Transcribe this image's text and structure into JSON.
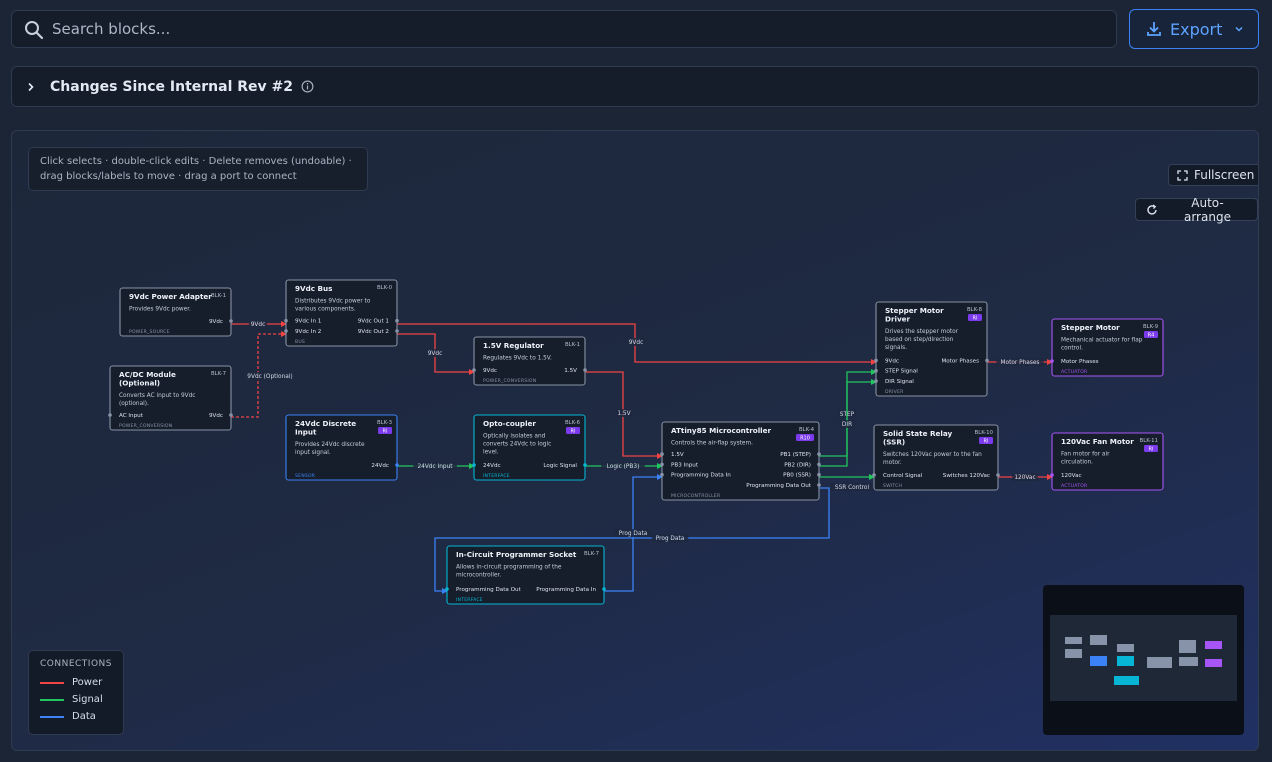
{
  "search": {
    "placeholder": "Search blocks..."
  },
  "export": {
    "label": "Export"
  },
  "changes": {
    "title": "Changes Since Internal Rev #2"
  },
  "canvas": {
    "hint": "Click selects · double-click edits · Delete removes (undoable) · drag blocks/labels to move · drag a port to connect",
    "fullscreen_label": "Fullscreen",
    "auto_arrange_label": "Auto-arrange"
  },
  "legend": {
    "title": "CONNECTIONS",
    "items": [
      {
        "label": "Power",
        "color": "#ef4444"
      },
      {
        "label": "Signal",
        "color": "#22c55e"
      },
      {
        "label": "Data",
        "color": "#3b82f6"
      }
    ]
  },
  "colors": {
    "power": "#ef4444",
    "signal": "#22c55e",
    "data": "#3b82f6",
    "accent": "#3b82f6",
    "sensor": "#3b82f6",
    "interface": "#06b6d4",
    "actuator": "#a855f7",
    "default_border": "#8893a6"
  },
  "blocks": [
    {
      "id": "BLK-1",
      "title": [
        "9Vdc Power Adapter"
      ],
      "desc": [
        "Provides 9Vdc power."
      ],
      "type": "POWER_SOURCE",
      "inputs": [],
      "outputs": [
        "9Vdc"
      ]
    },
    {
      "id": "BLK-7",
      "title": [
        "AC/DC Module",
        "(Optional)"
      ],
      "desc": [
        "Converts AC input to 9Vdc",
        "(optional)."
      ],
      "type": "POWER_CONVERSION",
      "inputs": [
        "AC Input"
      ],
      "outputs": [
        "9Vdc"
      ]
    },
    {
      "id": "BLK-0",
      "title": [
        "9Vdc Bus"
      ],
      "desc": [
        "Distributes 9Vdc power to",
        "various components."
      ],
      "type": "BUS",
      "inputs": [
        "9Vdc In 1",
        "9Vdc In 2"
      ],
      "outputs": [
        "9Vdc Out 1",
        "9Vdc Out 2"
      ]
    },
    {
      "id": "BLK-3",
      "title": [
        "24Vdc Discrete",
        "Input"
      ],
      "badge": "RI",
      "desc": [
        "Provides 24Vdc discrete",
        "input signal."
      ],
      "type": "SENSOR",
      "inputs": [],
      "outputs": [
        "24Vdc"
      ]
    },
    {
      "id": "BLK-1",
      "title": [
        "1.5V Regulator"
      ],
      "desc": [
        "Regulates 9Vdc to 1.5V."
      ],
      "type": "POWER_CONVERSION",
      "inputs": [
        "9Vdc"
      ],
      "outputs": [
        "1.5V"
      ]
    },
    {
      "id": "BLK-6",
      "title": [
        "Opto-coupler"
      ],
      "badge": "RI",
      "desc": [
        "Optically isolates and",
        "converts 24Vdc to logic",
        "level."
      ],
      "type": "INTERFACE",
      "inputs": [
        "24Vdc"
      ],
      "outputs": [
        "Logic Signal"
      ]
    },
    {
      "id": "BLK-4",
      "title": [
        "ATtiny85 Microcontroller"
      ],
      "badge": "R10",
      "desc": [
        "Controls the air-flap system."
      ],
      "type": "MICROCONTROLLER",
      "inputs": [
        "1.5V",
        "PB3 Input",
        "Programming Data In"
      ],
      "outputs": [
        "PB1 (STEP)",
        "PB2 (DIR)",
        "PB0 (SSR)",
        "Programming Data Out"
      ]
    },
    {
      "id": "BLK-7",
      "title": [
        "In-Circuit Programmer Socket"
      ],
      "desc": [
        "Allows in-circuit programming of the",
        "microcontroller."
      ],
      "type": "INTERFACE",
      "inputs": [
        "Programming Data Out"
      ],
      "outputs": [
        "Programming Data In"
      ]
    },
    {
      "id": "BLK-8",
      "title": [
        "Stepper Motor",
        "Driver"
      ],
      "badge": "RI",
      "desc": [
        "Drives the stepper motor",
        "based on step/direction",
        "signals."
      ],
      "type": "DRIVER",
      "inputs": [
        "9Vdc",
        "STEP Signal",
        "DIR Signal"
      ],
      "outputs": [
        "Motor Phases"
      ]
    },
    {
      "id": "BLK-10",
      "title": [
        "Solid State Relay",
        "(SSR)"
      ],
      "badge": "RI",
      "desc": [
        "Switches 120Vac power to the fan",
        "motor."
      ],
      "type": "SWITCH",
      "inputs": [
        "Control Signal"
      ],
      "outputs": [
        "Switches 120Vac"
      ]
    },
    {
      "id": "BLK-9",
      "title": [
        "Stepper Motor"
      ],
      "badge": "R4",
      "desc": [
        "Mechanical actuator for flap",
        "control."
      ],
      "type": "ACTUATOR",
      "inputs": [
        "Motor Phases"
      ],
      "outputs": []
    },
    {
      "id": "BLK-11",
      "title": [
        "120Vac Fan Motor"
      ],
      "badge": "RI",
      "desc": [
        "Fan motor for air",
        "circulation."
      ],
      "type": "ACTUATOR",
      "inputs": [
        "120Vac"
      ],
      "outputs": []
    }
  ],
  "edges": [
    {
      "kind": "power",
      "label": "9Vdc"
    },
    {
      "kind": "power",
      "label": "9Vdc (Optional)",
      "dashed": true
    },
    {
      "kind": "power",
      "label": "9Vdc"
    },
    {
      "kind": "power",
      "label": "9Vdc"
    },
    {
      "kind": "power",
      "label": "1.5V"
    },
    {
      "kind": "signal",
      "label": "24Vdc Input"
    },
    {
      "kind": "signal",
      "label": "Logic (PB3)"
    },
    {
      "kind": "signal",
      "label": "STEP"
    },
    {
      "kind": "signal",
      "label": "DIR"
    },
    {
      "kind": "signal",
      "label": "SSR Control"
    },
    {
      "kind": "power",
      "label": "Motor Phases"
    },
    {
      "kind": "power",
      "label": "120Vac"
    },
    {
      "kind": "data",
      "label": "Prog Data"
    },
    {
      "kind": "data",
      "label": "Prog Data"
    }
  ]
}
